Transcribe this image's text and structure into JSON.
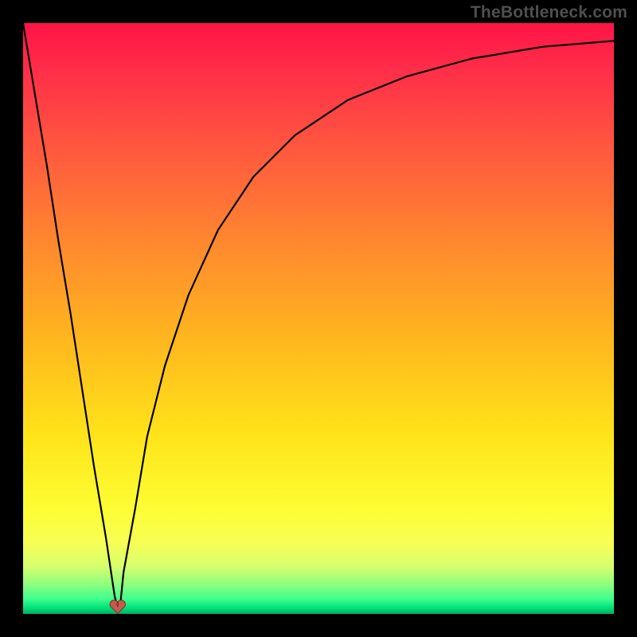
{
  "attribution": "TheBottleneck.com",
  "colors": {
    "frame": "#000000",
    "gradient_top": "#ff1446",
    "gradient_mid": "#ffd21e",
    "gradient_bottom": "#00b060",
    "curve": "#000000",
    "marker_fill": "#c75a4d",
    "marker_stroke": "#7a2d22"
  },
  "chart_data": {
    "type": "line",
    "title": "",
    "xlabel": "",
    "ylabel": "",
    "x": [
      0.0,
      0.02,
      0.04,
      0.06,
      0.08,
      0.1,
      0.12,
      0.14,
      0.155,
      0.16,
      0.165,
      0.17,
      0.19,
      0.21,
      0.24,
      0.28,
      0.33,
      0.39,
      0.46,
      0.55,
      0.65,
      0.76,
      0.88,
      1.0
    ],
    "y": [
      100,
      88,
      76,
      63,
      51,
      38,
      25,
      13,
      3,
      1,
      2,
      7,
      18,
      30,
      42,
      54,
      65,
      74,
      81,
      87,
      91,
      94,
      96,
      97
    ],
    "xlim": [
      0,
      1
    ],
    "ylim": [
      0,
      100
    ],
    "marker": {
      "x": 0.16,
      "y": 1
    },
    "note": "axes unlabeled in source image; values estimated from pixel positions on a 0–100 vertical / 0–1 horizontal normalised scale"
  }
}
